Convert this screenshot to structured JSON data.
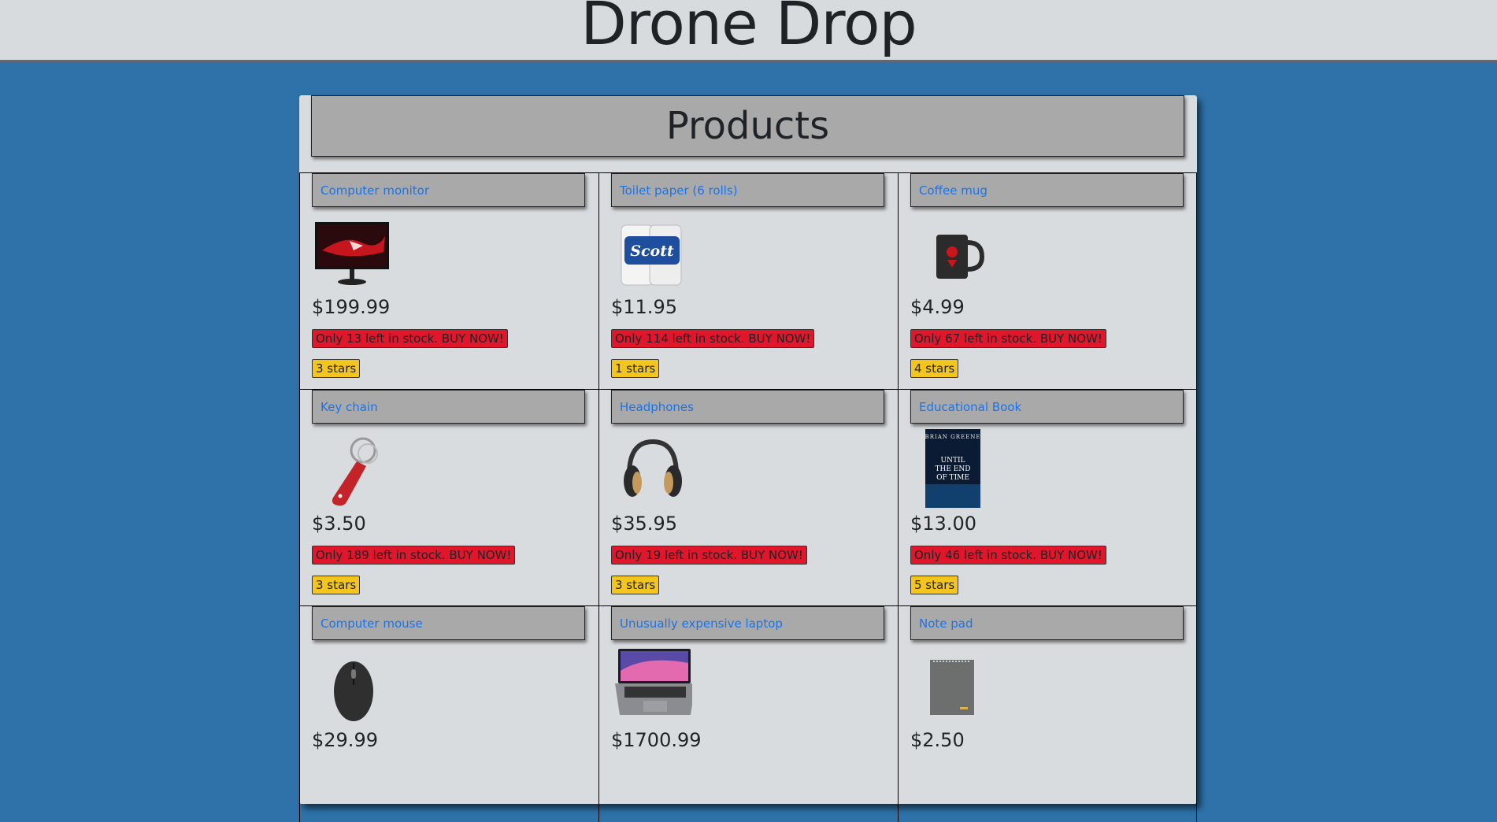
{
  "header": {
    "title": "Drone Drop"
  },
  "panel": {
    "title": "Products"
  },
  "products": [
    {
      "name": "Computer monitor",
      "price": "$199.99",
      "stock": "Only 13 left in stock. BUY NOW!",
      "rating": "3 stars",
      "image_icon": "monitor-icon"
    },
    {
      "name": "Toilet paper (6 rolls)",
      "price": "$11.95",
      "stock": "Only 114 left in stock. BUY NOW!",
      "rating": "1 stars",
      "image_icon": "toilet-paper-icon"
    },
    {
      "name": "Coffee mug",
      "price": "$4.99",
      "stock": "Only 67 left in stock. BUY NOW!",
      "rating": "4 stars",
      "image_icon": "mug-icon"
    },
    {
      "name": "Key chain",
      "price": "$3.50",
      "stock": "Only 189 left in stock. BUY NOW!",
      "rating": "3 stars",
      "image_icon": "keychain-icon"
    },
    {
      "name": "Headphones",
      "price": "$35.95",
      "stock": "Only 19 left in stock. BUY NOW!",
      "rating": "3 stars",
      "image_icon": "headphones-icon"
    },
    {
      "name": "Educational Book",
      "price": "$13.00",
      "stock": "Only 46 left in stock. BUY NOW!",
      "rating": "5 stars",
      "image_icon": "book-icon"
    },
    {
      "name": "Computer mouse",
      "price": "$29.99",
      "stock": "",
      "rating": "",
      "image_icon": "mouse-icon"
    },
    {
      "name": "Unusually expensive laptop",
      "price": "$1700.99",
      "stock": "",
      "rating": "",
      "image_icon": "laptop-icon"
    },
    {
      "name": "Note pad",
      "price": "$2.50",
      "stock": "",
      "rating": "",
      "image_icon": "notepad-icon"
    }
  ],
  "book_cover": {
    "author": "BRIAN GREENE",
    "title_lines": [
      "UNTIL",
      "THE END",
      "OF TIME"
    ]
  },
  "toilet_paper_brand": "Scott",
  "colors": {
    "background": "#2e72a9",
    "stock_badge": "#e0162b",
    "rating_badge": "#f3c51d",
    "link": "#1b73e8"
  }
}
